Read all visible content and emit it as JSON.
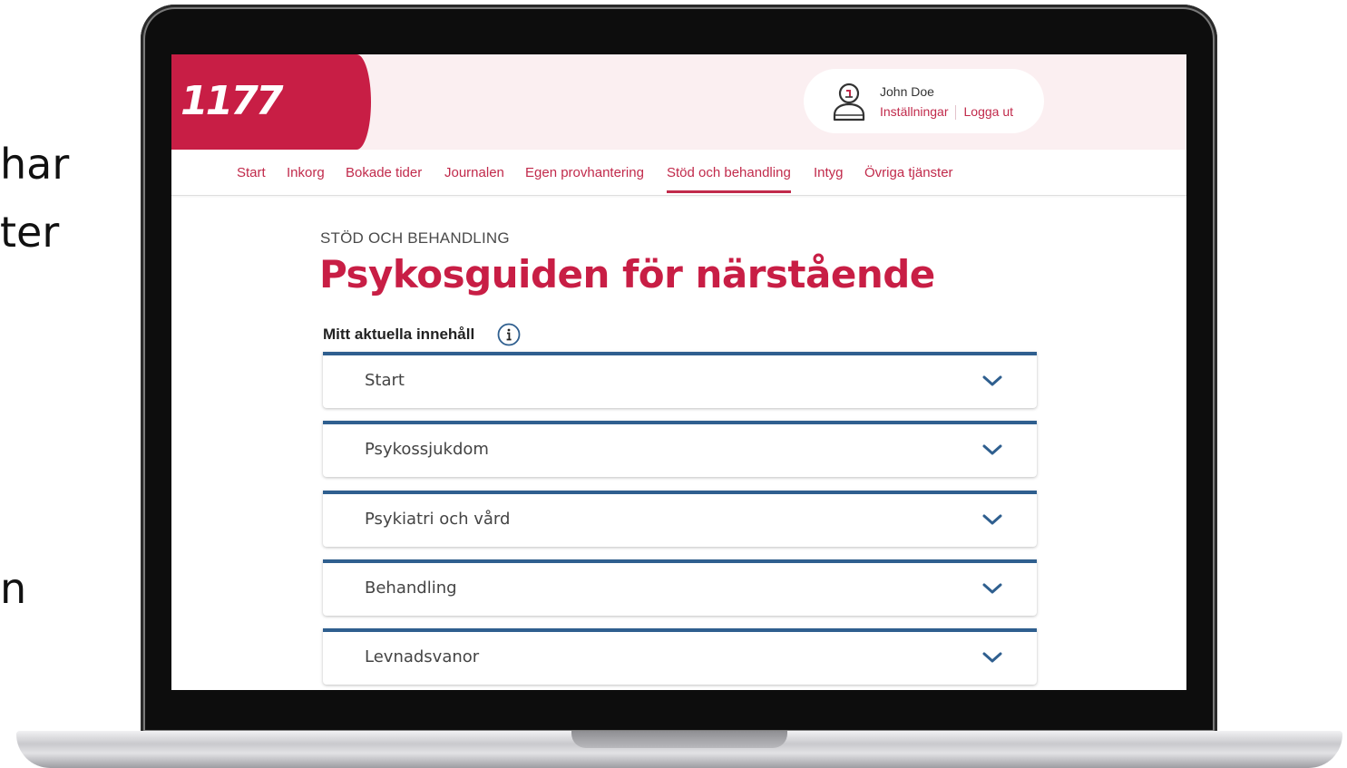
{
  "slide_fragments": [
    "har",
    "ter",
    "n"
  ],
  "header": {
    "logo": "1177",
    "user": {
      "name": "John Doe",
      "settings_link": "Inställningar",
      "logout_link": "Logga ut"
    }
  },
  "nav": {
    "items": [
      "Start",
      "Inkorg",
      "Bokade tider",
      "Journalen",
      "Egen provhantering",
      "Stöd och behandling",
      "Intyg",
      "Övriga tjänster"
    ],
    "active": "Stöd och behandling"
  },
  "page": {
    "kicker": "STÖD OCH BEHANDLING",
    "title": "Psykosguiden för närstående",
    "section_label": "Mitt aktuella innehåll"
  },
  "accordion": {
    "items": [
      "Start",
      "Psykossjukdom",
      "Psykiatri och vård",
      "Behandling",
      "Levnadsvanor"
    ]
  },
  "colors": {
    "brand_red": "#c81e45",
    "link_red": "#c12a4b",
    "accordion_border": "#2f5f8f",
    "header_bg": "#fbeff1"
  },
  "icons": {
    "user": "user-icon",
    "info": "info-icon",
    "expand": "chevron-down-icon"
  }
}
